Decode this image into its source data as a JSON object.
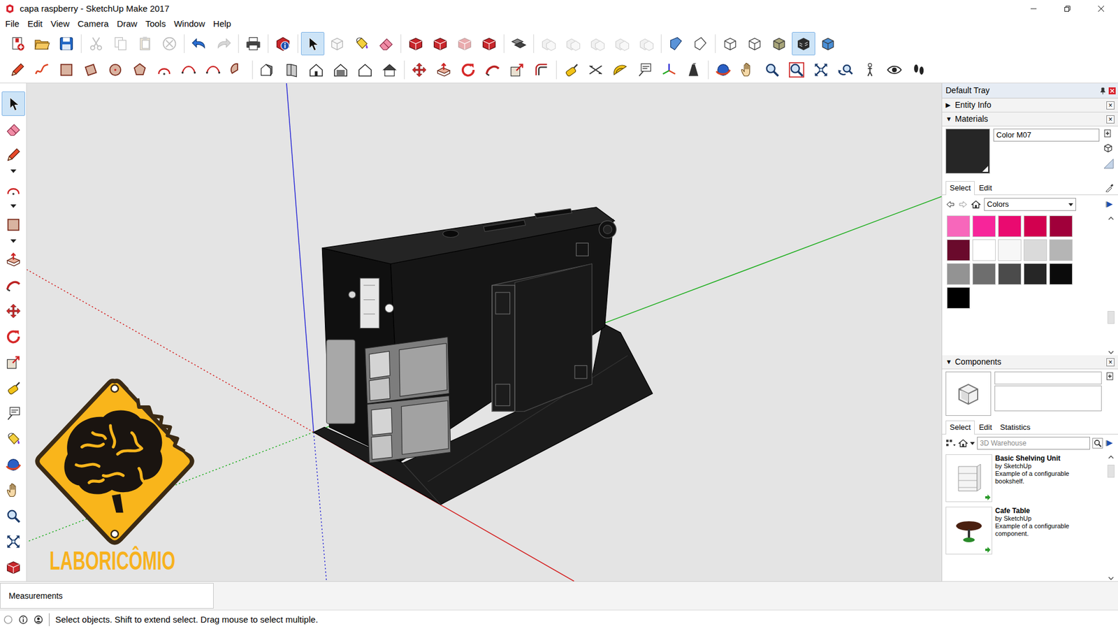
{
  "window": {
    "title": "capa raspberry - SketchUp Make 2017"
  },
  "menu": [
    "File",
    "Edit",
    "View",
    "Camera",
    "Draw",
    "Tools",
    "Window",
    "Help"
  ],
  "toolbars": {
    "standard": [
      {
        "selected": false,
        "disabled": false
      },
      {
        "selected": false,
        "disabled": false
      },
      {
        "selected": false,
        "disabled": false
      },
      {
        "selected": false,
        "disabled": true
      },
      {
        "selected": false,
        "disabled": true
      },
      {
        "selected": false,
        "disabled": true
      },
      {
        "selected": false,
        "disabled": true
      },
      {
        "selected": false,
        "disabled": false
      },
      {
        "selected": false,
        "disabled": true
      },
      {
        "selected": false,
        "disabled": false
      },
      {
        "selected": false,
        "disabled": false
      },
      {
        "selected": true,
        "disabled": false
      },
      {
        "selected": false,
        "disabled": true
      },
      {
        "selected": false,
        "disabled": false
      },
      {
        "selected": false,
        "disabled": false
      },
      {
        "selected": false,
        "disabled": false
      },
      {
        "selected": false,
        "disabled": false
      },
      {
        "selected": false,
        "disabled": true
      },
      {
        "selected": false,
        "disabled": false
      },
      {
        "selected": false,
        "disabled": false
      },
      {
        "selected": false,
        "disabled": true
      },
      {
        "selected": false,
        "disabled": true
      },
      {
        "selected": false,
        "disabled": true
      },
      {
        "selected": false,
        "disabled": true
      },
      {
        "selected": false,
        "disabled": true
      },
      {
        "selected": false,
        "disabled": false
      },
      {
        "selected": false,
        "disabled": false
      },
      {
        "selected": false,
        "disabled": false
      },
      {
        "selected": false,
        "disabled": false
      },
      {
        "selected": false,
        "disabled": false
      },
      {
        "selected": true,
        "disabled": false
      },
      {
        "selected": false,
        "disabled": false
      }
    ],
    "large": [
      {
        "selected": false,
        "disabled": false
      },
      {
        "selected": false,
        "disabled": false
      },
      {
        "selected": false,
        "disabled": false
      },
      {
        "selected": false,
        "disabled": false
      },
      {
        "selected": false,
        "disabled": false
      },
      {
        "selected": false,
        "disabled": false
      },
      {
        "selected": false,
        "disabled": false
      },
      {
        "selected": false,
        "disabled": false
      },
      {
        "selected": false,
        "disabled": false
      },
      {
        "selected": false,
        "disabled": false
      },
      {
        "selected": false,
        "disabled": false
      },
      {
        "selected": false,
        "disabled": false
      },
      {
        "selected": false,
        "disabled": false
      },
      {
        "selected": false,
        "disabled": false
      },
      {
        "selected": false,
        "disabled": false
      },
      {
        "selected": false,
        "disabled": false
      },
      {
        "selected": false,
        "disabled": false
      },
      {
        "selected": false,
        "disabled": false
      },
      {
        "selected": false,
        "disabled": false
      },
      {
        "selected": false,
        "disabled": false
      },
      {
        "selected": false,
        "disabled": false
      },
      {
        "selected": false,
        "disabled": false
      },
      {
        "selected": false,
        "disabled": false
      },
      {
        "selected": false,
        "disabled": false
      },
      {
        "selected": false,
        "disabled": false
      },
      {
        "selected": false,
        "disabled": false
      },
      {
        "selected": false,
        "disabled": false
      },
      {
        "selected": false,
        "disabled": false
      },
      {
        "selected": false,
        "disabled": false
      },
      {
        "selected": false,
        "disabled": false
      },
      {
        "selected": false,
        "disabled": false
      },
      {
        "selected": false,
        "disabled": false
      },
      {
        "selected": false,
        "disabled": false
      },
      {
        "selected": false,
        "disabled": false
      },
      {
        "selected": false,
        "disabled": false
      },
      {
        "selected": false,
        "disabled": false
      },
      {
        "selected": false,
        "disabled": false
      }
    ],
    "side": [
      {
        "selected": true,
        "disabled": false
      },
      {
        "selected": false,
        "disabled": false
      },
      {
        "selected": false,
        "disabled": false
      },
      {
        "selected": false,
        "disabled": false
      },
      {
        "selected": false,
        "disabled": false
      },
      {
        "selected": false,
        "disabled": false
      },
      {
        "selected": false,
        "disabled": false
      },
      {
        "selected": false,
        "disabled": false
      },
      {
        "selected": false,
        "disabled": false
      },
      {
        "selected": false,
        "disabled": false
      },
      {
        "selected": false,
        "disabled": false
      },
      {
        "selected": false,
        "disabled": false
      },
      {
        "selected": false,
        "disabled": false
      },
      {
        "selected": false,
        "disabled": false
      },
      {
        "selected": false,
        "disabled": false
      },
      {
        "selected": false,
        "disabled": false
      },
      {
        "selected": false,
        "disabled": false
      },
      {
        "selected": false,
        "disabled": false
      }
    ]
  },
  "viewport": {
    "watermark": "LABORICÔMIO"
  },
  "tray": {
    "title": "Default Tray",
    "entity_info": {
      "arrow": "▶",
      "title": "Entity Info",
      "expanded": false,
      "close": "×"
    },
    "materials": {
      "arrow": "▼",
      "title": "Materials",
      "expanded": true,
      "close": "×",
      "name": "Color M07",
      "preview_color": "#262626",
      "tabs": [
        {
          "label": "Select",
          "selected": true
        },
        {
          "label": "Edit",
          "selected": false
        }
      ],
      "library": "Colors",
      "swatches": [
        {
          "color": "#f767bb"
        },
        {
          "color": "#f7259a"
        },
        {
          "color": "#ea0a70"
        },
        {
          "color": "#d2004f"
        },
        {
          "color": "#a0003a"
        },
        {
          "color": "#6a0a2c"
        },
        {
          "color": "#ffffff"
        },
        {
          "color": "#f7f7f7"
        },
        {
          "color": "#dadada"
        },
        {
          "color": "#b5b5b5"
        },
        {
          "color": "#939393"
        },
        {
          "color": "#6e6e6e"
        },
        {
          "color": "#4b4b4b"
        },
        {
          "color": "#262626"
        },
        {
          "color": "#0b0b0b"
        },
        {
          "color": "#000000"
        }
      ]
    },
    "components": {
      "arrow": "▼",
      "title": "Components",
      "expanded": true,
      "close": "×",
      "tabs": [
        {
          "label": "Select",
          "selected": true
        },
        {
          "label": "Edit",
          "selected": false
        },
        {
          "label": "Statistics",
          "selected": false
        }
      ],
      "search": {
        "placeholder": "3D Warehouse"
      },
      "items": [
        {
          "title": "Basic Shelving Unit",
          "author": "by SketchUp",
          "description": "Example of a configurable bookshelf."
        },
        {
          "title": "Cafe Table",
          "author": "by SketchUp",
          "description": "Example of a configurable component."
        }
      ]
    }
  },
  "measurements": {
    "label": "Measurements"
  },
  "status_bar": {
    "text": "Select objects. Shift to extend select. Drag mouse to select multiple."
  }
}
